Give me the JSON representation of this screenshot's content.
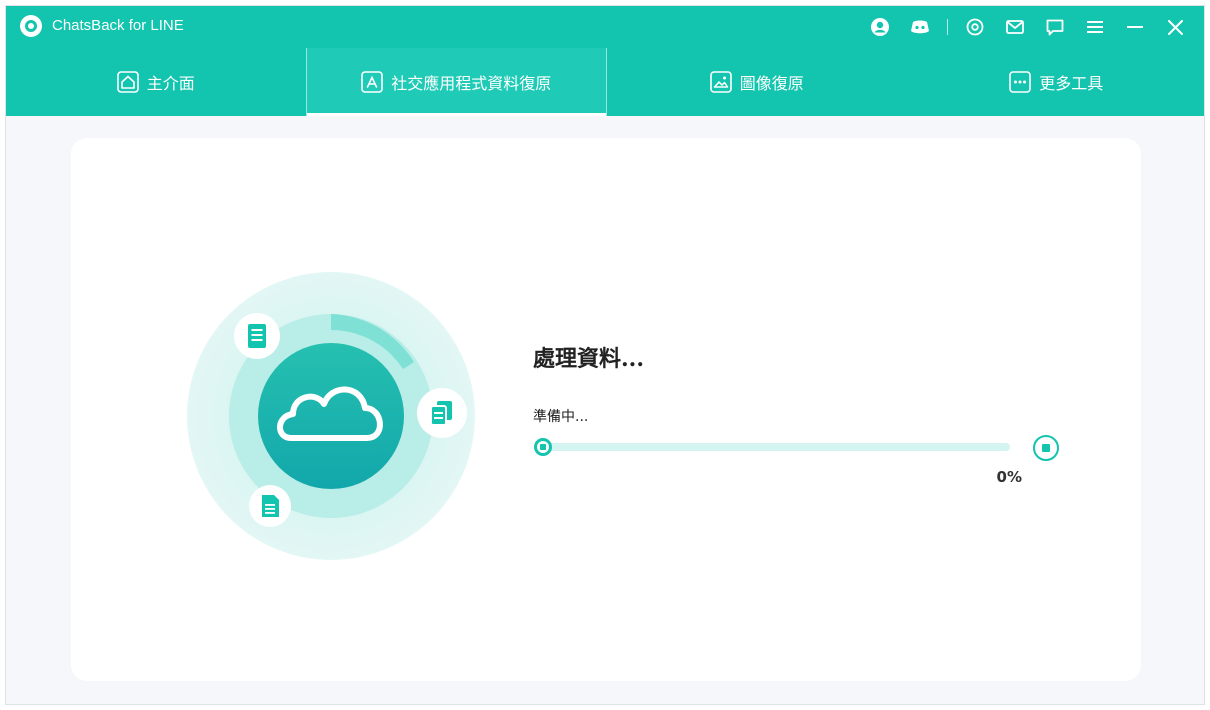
{
  "app": {
    "title": "ChatsBack for LINE",
    "accent_color": "#13c4ae"
  },
  "titlebar_icons": [
    {
      "name": "account-icon"
    },
    {
      "name": "discord-icon"
    },
    {
      "name": "settings-icon"
    },
    {
      "name": "mail-icon"
    },
    {
      "name": "feedback-icon"
    },
    {
      "name": "menu-icon"
    },
    {
      "name": "minimize-icon"
    },
    {
      "name": "close-icon"
    }
  ],
  "nav": {
    "tabs": [
      {
        "label": "主介面",
        "icon": "home-icon",
        "active": false
      },
      {
        "label": "社交應用程式資料復原",
        "icon": "app-store-icon",
        "active": true
      },
      {
        "label": "圖像復原",
        "icon": "image-icon",
        "active": false
      },
      {
        "label": "更多工具",
        "icon": "more-icon",
        "active": false
      }
    ]
  },
  "processing": {
    "title": "處理資料...",
    "subtitle": "準備中...",
    "progress": 0,
    "percent_label": "0%"
  },
  "illustration": {
    "icons": [
      "document-icon",
      "copy-icon",
      "file-icon",
      "cloud-icon"
    ]
  }
}
